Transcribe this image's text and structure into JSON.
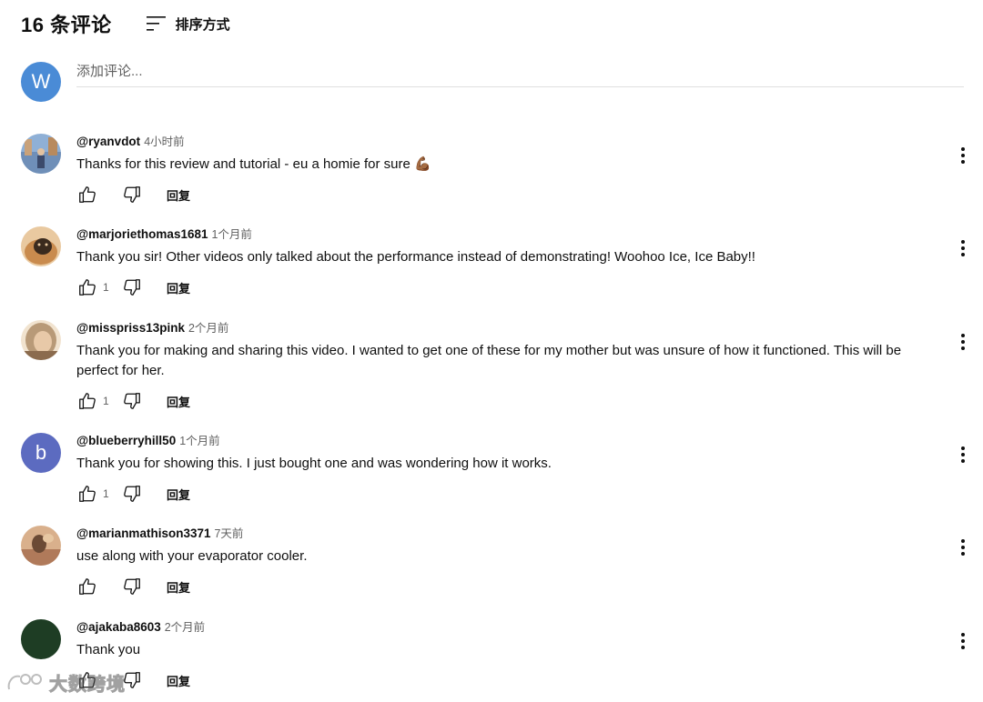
{
  "header": {
    "count_label": "16 条评论",
    "sort_label": "排序方式"
  },
  "add_comment": {
    "avatar_letter": "W",
    "avatar_color": "#4a8bd6",
    "placeholder": "添加评论..."
  },
  "comments": [
    {
      "author": "@ryanvdot",
      "time": "4小时前",
      "text": "Thanks for this review and tutorial - eu a homie for sure 💪🏾",
      "likes": "",
      "reply_label": "回复",
      "avatar_colors": [
        "#6f8fb8",
        "#3b4a6b",
        "#c9a27a"
      ]
    },
    {
      "author": "@marjoriethomas1681",
      "time": "1个月前",
      "text": "Thank you sir!  Other videos only talked about the performance instead of demonstrating!  Woohoo Ice, Ice Baby!!",
      "likes": "1",
      "reply_label": "回复",
      "avatar_colors": [
        "#c98b4e",
        "#3a2a1e",
        "#e9c9a0"
      ]
    },
    {
      "author": "@misspriss13pink",
      "time": "2个月前",
      "text": "Thank you for making and sharing this video. I wanted to get one of these for my mother but was unsure of how it functioned. This will be perfect for her.",
      "likes": "1",
      "reply_label": "回复",
      "avatar_colors": [
        "#d8c3a5",
        "#8b6b4e",
        "#f1e3cf"
      ]
    },
    {
      "author": "@blueberryhill50",
      "time": "1个月前",
      "text": "Thank you for showing this.  I just bought one and was wondering how it works.",
      "likes": "1",
      "reply_label": "回复",
      "avatar_letter": "b",
      "avatar_color": "#5c6bc0"
    },
    {
      "author": "@marianmathison3371",
      "time": "7天前",
      "text": "use along with your evaporator cooler.",
      "likes": "",
      "reply_label": "回复",
      "avatar_colors": [
        "#b07a5a",
        "#6b4a35",
        "#d9b08c"
      ]
    },
    {
      "author": "@ajakaba8603",
      "time": "2个月前",
      "text": "Thank you",
      "likes": "",
      "reply_label": "回复",
      "avatar_color": "#1e3d24"
    }
  ],
  "watermark": {
    "text": "大数跨境"
  }
}
